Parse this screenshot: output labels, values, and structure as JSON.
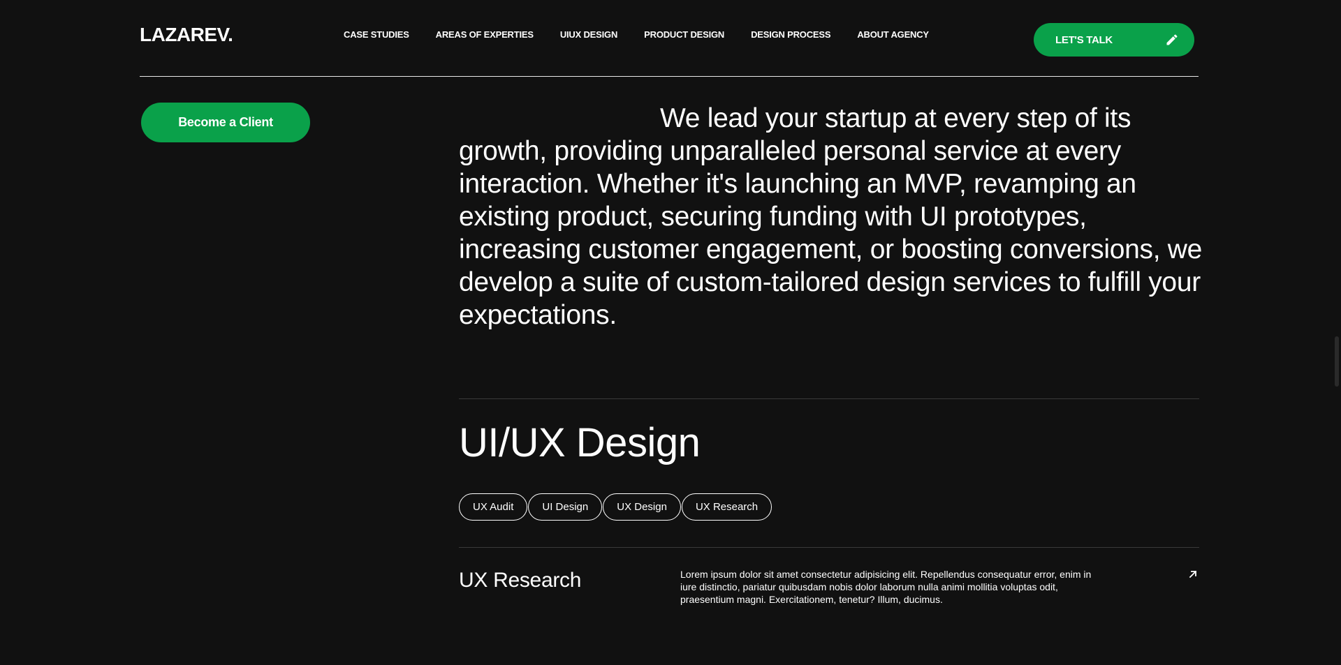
{
  "header": {
    "logo": "LAZAREV.",
    "nav": [
      "CASE STUDIES",
      "AREAS OF EXPERTIES",
      "UIUX DESIGN",
      "PRODUCT DESIGN",
      "DESIGN PROCESS",
      "ABOUT AGENCY"
    ],
    "cta_label": "LET'S TALK",
    "cta_icon": "pencil-icon"
  },
  "client_button": "Become a Client",
  "intro": "We lead your startup at every step of its growth, providing unparalleled personal service at every interaction. Whether it's launching an MVP, revamping an existing product, securing funding with UI prototypes, increasing customer engagement, or boosting conversions, we develop a suite of custom-tailored design services to fulfill your expectations.",
  "section": {
    "title": "UI/UX Design",
    "tags": [
      "UX Audit",
      "UI Design",
      "UX Design",
      "UX Research"
    ],
    "rows": [
      {
        "title": "UX Research",
        "description": "Lorem ipsum dolor sit amet consectetur adipisicing elit. Repellendus consequatur error, enim in iure distinctio, pariatur quibusdam nobis dolor laborum nulla animi mollitia voluptas odit, praesentium magni. Exercitationem, tenetur? Illum, ducimus.",
        "icon": "arrow-up-right-icon"
      }
    ]
  },
  "colors": {
    "background": "#111111",
    "accent": "#0aa14a",
    "text": "#ffffff"
  }
}
